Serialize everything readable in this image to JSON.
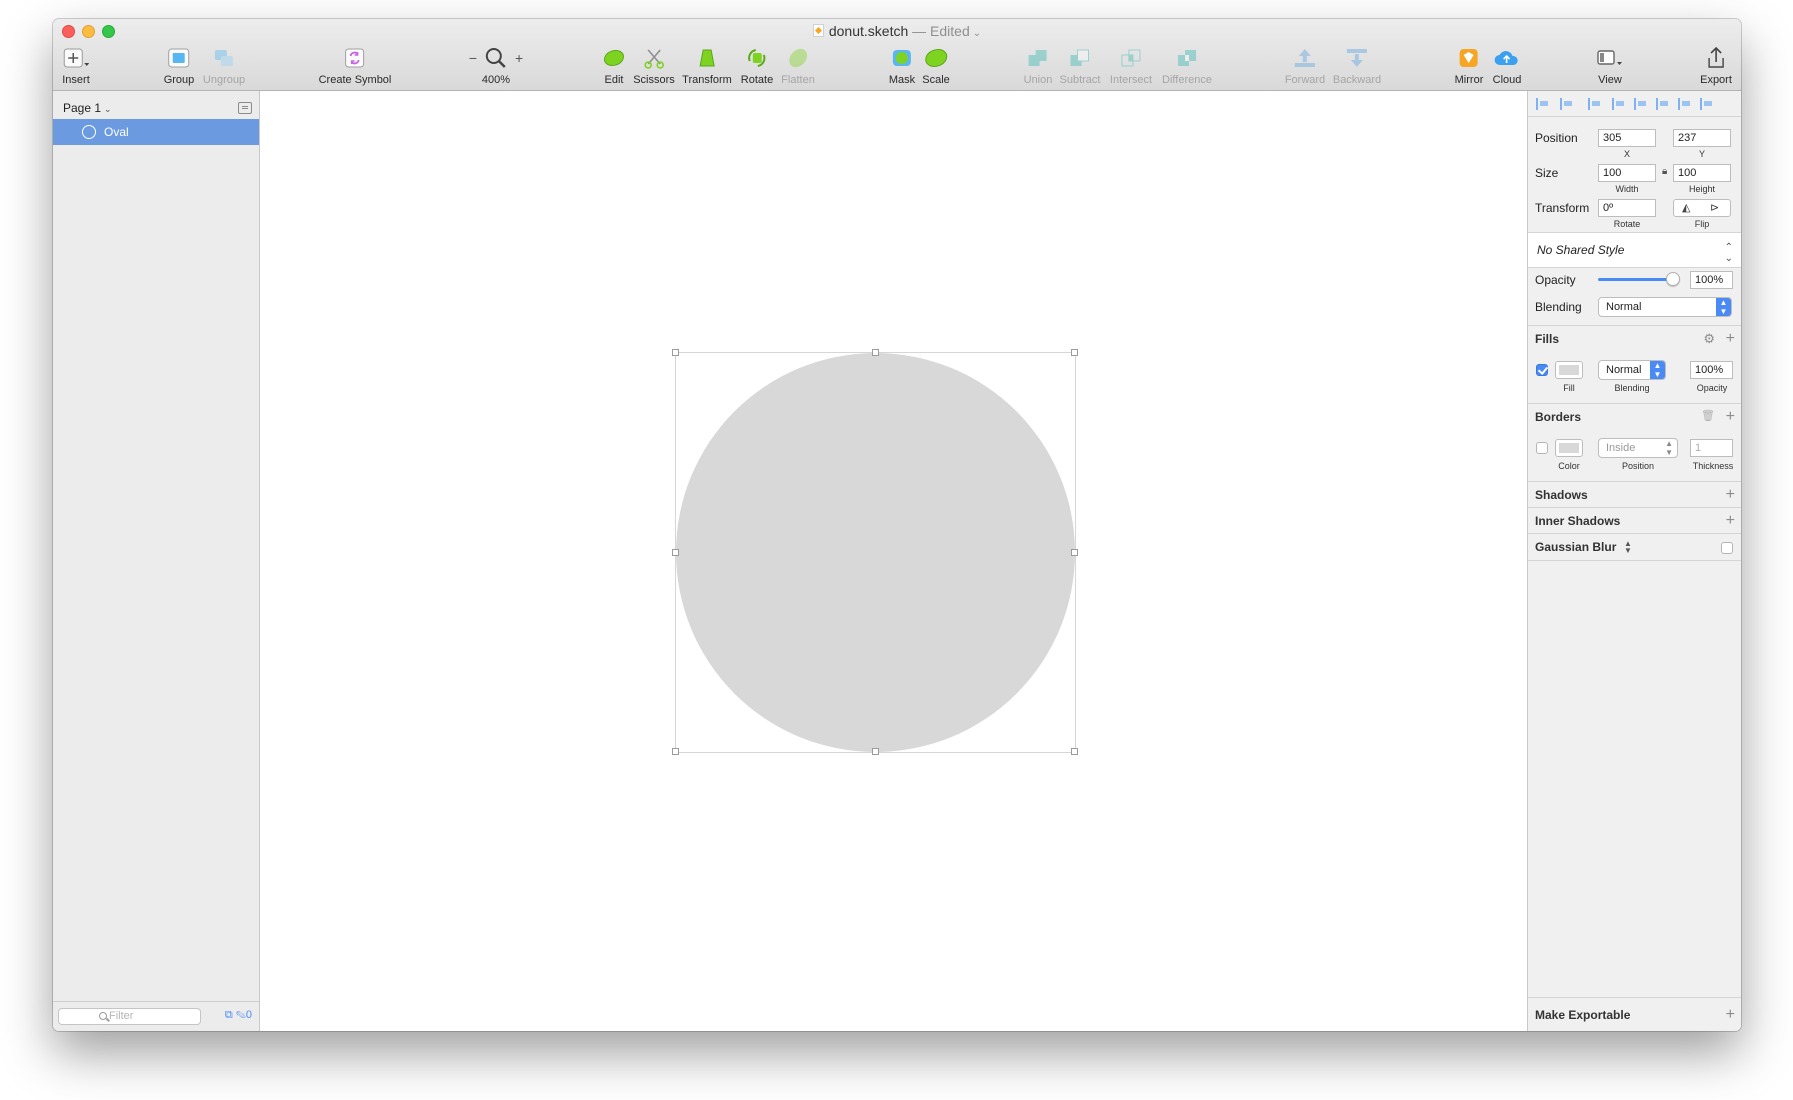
{
  "window": {
    "title_filename": "donut.sketch",
    "title_status": "— Edited",
    "title_chevron": "⌄"
  },
  "toolbar": {
    "insert": "Insert",
    "group": "Group",
    "ungroup": "Ungroup",
    "create_symbol": "Create Symbol",
    "zoom_minus": "−",
    "zoom_plus": "+",
    "zoom_level": "400%",
    "edit": "Edit",
    "scissors": "Scissors",
    "transform": "Transform",
    "rotate": "Rotate",
    "flatten": "Flatten",
    "mask": "Mask",
    "scale": "Scale",
    "union": "Union",
    "subtract": "Subtract",
    "intersect": "Intersect",
    "difference": "Difference",
    "forward": "Forward",
    "backward": "Backward",
    "mirror": "Mirror",
    "cloud": "Cloud",
    "view": "View",
    "export": "Export"
  },
  "layers": {
    "page_name": "Page 1",
    "items": [
      {
        "name": "Oval",
        "icon": "oval-icon",
        "selected": true
      }
    ],
    "filter_placeholder": "Filter",
    "badge_count": "0"
  },
  "inspector": {
    "position_label": "Position",
    "x_value": "305",
    "y_value": "237",
    "x_label": "X",
    "y_label": "Y",
    "size_label": "Size",
    "width_value": "100",
    "height_value": "100",
    "width_label": "Width",
    "height_label": "Height",
    "transform_label": "Transform",
    "rotate_value": "0º",
    "rotate_label": "Rotate",
    "flip_label": "Flip",
    "shared_style": "No Shared Style",
    "opacity_label": "Opacity",
    "opacity_value": "100%",
    "opacity_fraction": 1.0,
    "blending_label": "Blending",
    "blending_value": "Normal",
    "fills": {
      "title": "Fills",
      "enabled": true,
      "blend_value": "Normal",
      "opacity_value": "100%",
      "fill_label": "Fill",
      "blending_label": "Blending",
      "opacity_label": "Opacity"
    },
    "borders": {
      "title": "Borders",
      "enabled": false,
      "position_value": "Inside",
      "thickness_value": "1",
      "color_label": "Color",
      "position_label": "Position",
      "thickness_label": "Thickness"
    },
    "shadows_title": "Shadows",
    "inner_shadows_title": "Inner Shadows",
    "gaussian_blur_title": "Gaussian Blur",
    "make_exportable": "Make Exportable"
  },
  "colors": {
    "selection_blue": "#6b9ae0",
    "accent_blue": "#4a8af4",
    "oval_fill": "#d8d8d8"
  }
}
